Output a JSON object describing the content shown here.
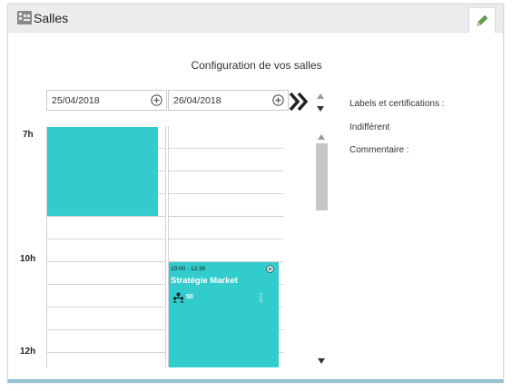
{
  "header": {
    "title": "Salles",
    "icon": "building-icon",
    "edit_icon": "pencil-icon"
  },
  "config_title": "Configuration de vos salles",
  "dates": [
    {
      "label": "25/04/2018",
      "add_icon": "plus-circle-icon"
    },
    {
      "label": "26/04/2018",
      "add_icon": "plus-circle-icon"
    }
  ],
  "nav": {
    "next_icon": "double-chevron-right-icon"
  },
  "hours": [
    "7h",
    "10h",
    "12h"
  ],
  "events": [
    {
      "time": "10:00 - 12:30",
      "title": "Stratégie Market",
      "count": "50",
      "color": "#33cccc"
    }
  ],
  "side": {
    "labels_title": "Labels et certifications :",
    "labels_value": "Indifférent",
    "comment_title": "Commentaire :"
  },
  "colors": {
    "event": "#33cccc",
    "accent_border": "#8fc3d2"
  }
}
